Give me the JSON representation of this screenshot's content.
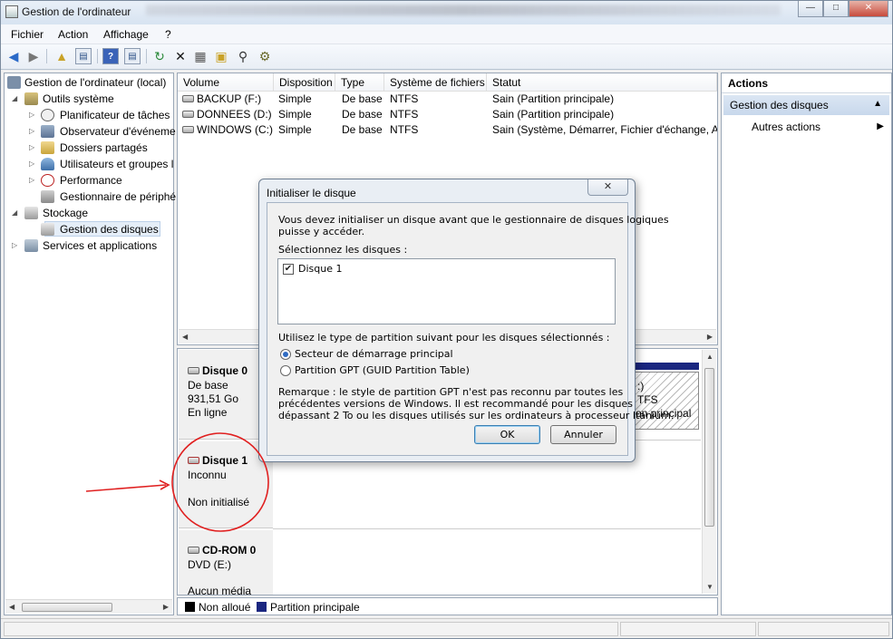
{
  "window": {
    "title": "Gestion de l'ordinateur"
  },
  "window_buttons": {
    "minimize": "—",
    "maximize": "□",
    "close": "✕"
  },
  "menu": {
    "file": "Fichier",
    "action": "Action",
    "view": "Affichage",
    "help": "?"
  },
  "toolbar": {
    "icons": [
      "back-arrow-icon",
      "forward-arrow-icon",
      "up-folder-icon",
      "show-tree-icon",
      "help-icon",
      "help-topics-icon",
      "refresh-icon",
      "delete-icon",
      "properties-icon",
      "open-icon",
      "search-icon",
      "settings-icon"
    ]
  },
  "tree": {
    "root": "Gestion de l'ordinateur (local)",
    "system_tools": "Outils système",
    "task_scheduler": "Planificateur de tâches",
    "event_viewer": "Observateur d'événeme",
    "shared_folders": "Dossiers partagés",
    "local_users": "Utilisateurs et groupes l",
    "performance": "Performance",
    "device_manager": "Gestionnaire de périphé",
    "storage": "Stockage",
    "disk_management": "Gestion des disques",
    "services": "Services et applications"
  },
  "volumes": {
    "columns": [
      "Volume",
      "Disposition",
      "Type",
      "Système de fichiers",
      "Statut"
    ],
    "rows": [
      [
        "BACKUP (F:)",
        "Simple",
        "De base",
        "NTFS",
        "Sain (Partition principale)"
      ],
      [
        "DONNEES (D:)",
        "Simple",
        "De base",
        "NTFS",
        "Sain (Partition principale)"
      ],
      [
        "WINDOWS (C:)",
        "Simple",
        "De base",
        "NTFS",
        "Sain (Système, Démarrer, Fichier d'échange, Ac"
      ]
    ]
  },
  "disks": {
    "disk0": {
      "name": "Disque 0",
      "type": "De base",
      "size": "931,51 Go",
      "status": "En ligne"
    },
    "disk1": {
      "name": "Disque 1",
      "type": "Inconnu",
      "status": "Non initialisé"
    },
    "cdrom": {
      "name": "CD-ROM 0",
      "type": "DVD (E:)",
      "status": "Aucun média"
    },
    "partition_partial": {
      "line1": ":)",
      "line2": "TFS",
      "line3": "on principal"
    }
  },
  "legend": {
    "unallocated": "Non alloué",
    "primary": "Partition principale",
    "unallocated_color": "#000000",
    "primary_color": "#1a2680"
  },
  "actions": {
    "header": "Actions",
    "group": "Gestion des disques",
    "more": "Autres actions"
  },
  "dialog": {
    "title": "Initialiser le disque",
    "close": "✕",
    "intro_line1": "Vous devez initialiser un disque avant que le gestionnaire de disques logiques",
    "intro_line2": "puisse y accéder.",
    "select_label": "Sélectionnez les disques :",
    "disk_item": "Disque 1",
    "disk_item_checked": "✔",
    "partition_label": "Utilisez le type de partition suivant pour les disques sélectionnés :",
    "option_mbr": "Secteur de démarrage principal",
    "option_gpt": "Partition GPT (GUID Partition Table)",
    "note_line1": "Remarque : le style de partition GPT n'est pas reconnu par toutes les",
    "note_line2": "précédentes versions de Windows. Il est recommandé pour les disques",
    "note_line3": "dépassant 2 To ou les disques utilisés sur les ordinateurs à processeur Itanium.",
    "ok": "OK",
    "cancel": "Annuler"
  },
  "colors": {
    "annotation": "#e02020",
    "selection": "#c8d8ec"
  }
}
